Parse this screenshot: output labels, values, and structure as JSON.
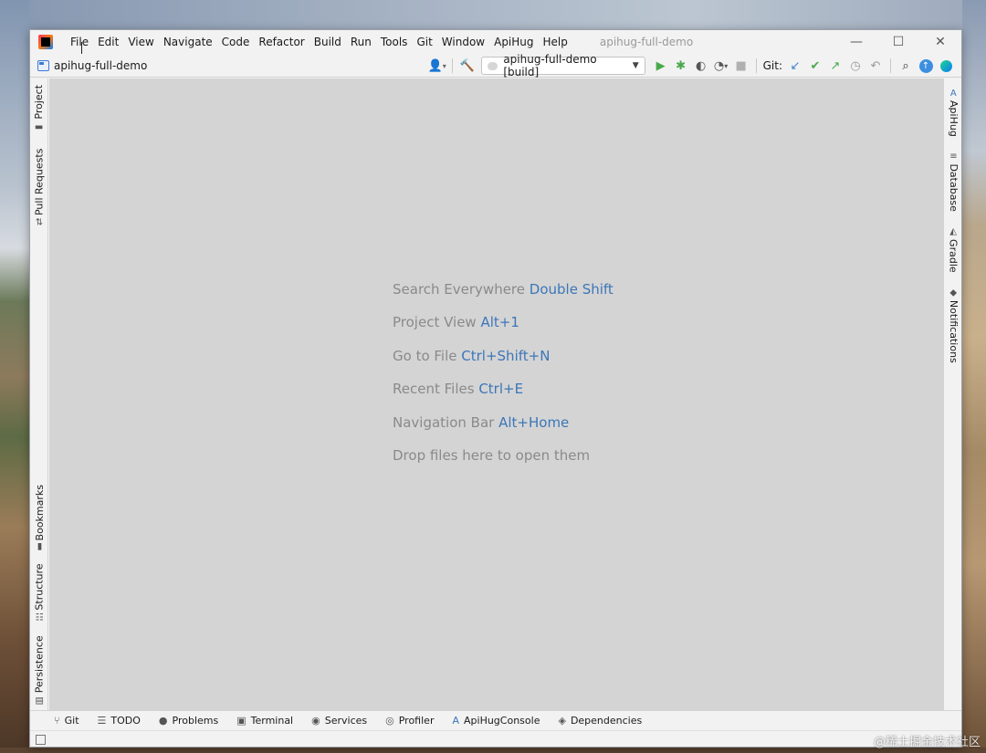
{
  "window": {
    "title": "apihug-full-demo",
    "minimize": "—",
    "maximize": "☐",
    "close": "✕"
  },
  "menu": [
    "File",
    "Edit",
    "View",
    "Navigate",
    "Code",
    "Refactor",
    "Build",
    "Run",
    "Tools",
    "Git",
    "Window",
    "ApiHug",
    "Help"
  ],
  "toolbar": {
    "project_name": "apihug-full-demo",
    "run_config": "apihug-full-demo [build]",
    "git_label": "Git:"
  },
  "left_tabs": {
    "project": "Project",
    "pull_requests": "Pull Requests",
    "bookmarks": "Bookmarks",
    "structure": "Structure",
    "persistence": "Persistence"
  },
  "right_tabs": {
    "apihug": "ApiHug",
    "database": "Database",
    "gradle": "Gradle",
    "notifications": "Notifications"
  },
  "editor_hints": [
    {
      "text": "Search Everywhere",
      "shortcut": "Double Shift"
    },
    {
      "text": "Project View",
      "shortcut": "Alt+1"
    },
    {
      "text": "Go to File",
      "shortcut": "Ctrl+Shift+N"
    },
    {
      "text": "Recent Files",
      "shortcut": "Ctrl+E"
    },
    {
      "text": "Navigation Bar",
      "shortcut": "Alt+Home"
    },
    {
      "text": "Drop files here to open them",
      "shortcut": ""
    }
  ],
  "bottom_tabs": {
    "git": "Git",
    "todo": "TODO",
    "problems": "Problems",
    "terminal": "Terminal",
    "services": "Services",
    "profiler": "Profiler",
    "apihug_console": "ApiHugConsole",
    "dependencies": "Dependencies"
  },
  "watermark": "@稀土掘金技术社区",
  "colors": {
    "editor_bg": "#d4d4d4",
    "hint_text": "#8a8a8a",
    "shortcut_text": "#3c76b8",
    "chrome_bg": "#f2f2f2"
  }
}
